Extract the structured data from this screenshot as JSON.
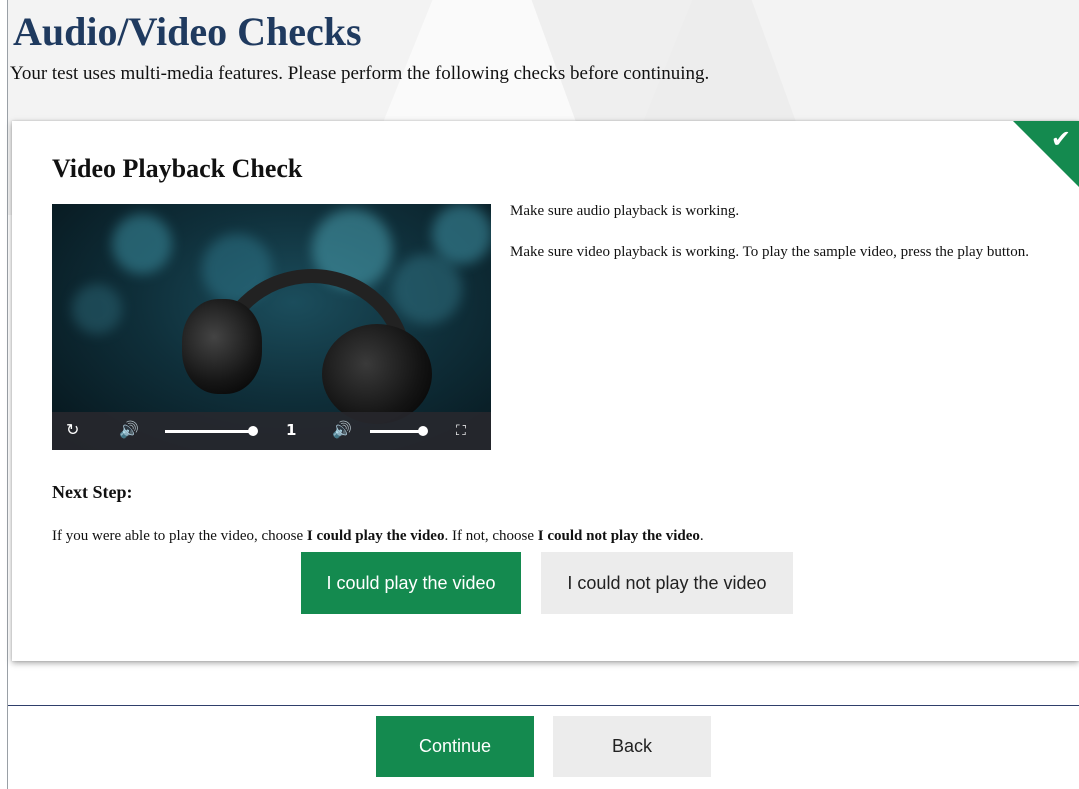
{
  "header": {
    "title": "Audio/Video Checks",
    "subtitle": "Your test uses multi-media features. Please perform the following checks before continuing."
  },
  "card": {
    "title": "Video Playback Check",
    "status_icon": "check-icon",
    "instructions": [
      "Make sure audio playback is working.",
      "Make sure video playback is working. To play the sample video, press the play button."
    ],
    "video": {
      "playback_rate": "1",
      "seek_progress": 1.0,
      "volume_level": 1.0,
      "icons": [
        "replay-icon",
        "volume-icon",
        "volume-icon",
        "fullscreen-icon"
      ]
    },
    "next_step": {
      "heading": "Next Step:",
      "text_before": "If you were able to play the video, choose ",
      "choice_yes": "I could play the video",
      "text_middle": ". If not, choose ",
      "choice_no": "I could not play the video",
      "text_after": "."
    },
    "buttons": {
      "could": "I could play the video",
      "could_not": "I could not play the video"
    }
  },
  "footer": {
    "continue_label": "Continue",
    "back_label": "Back"
  },
  "colors": {
    "primary_green": "#148a4f",
    "title_navy": "#1f3a5f",
    "secondary_button": "#ececec"
  }
}
